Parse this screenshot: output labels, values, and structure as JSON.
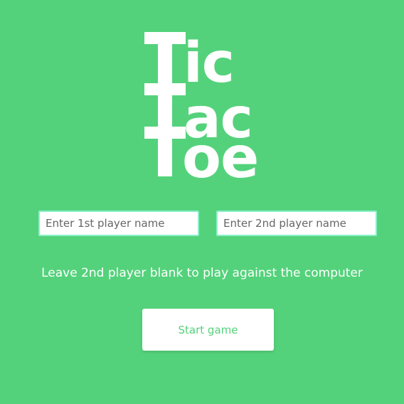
{
  "logo": {
    "line1": "ic",
    "line2": "ac",
    "line3": "oe"
  },
  "form": {
    "player1_placeholder": "Enter 1st player name",
    "player1_value": "",
    "player2_placeholder": "Enter 2nd player name",
    "player2_value": "",
    "hint": "Leave 2nd player blank to play against the computer",
    "start_label": "Start game"
  },
  "colors": {
    "background": "#54d27b",
    "input_border": "#8af0c8",
    "text": "#ffffff"
  }
}
